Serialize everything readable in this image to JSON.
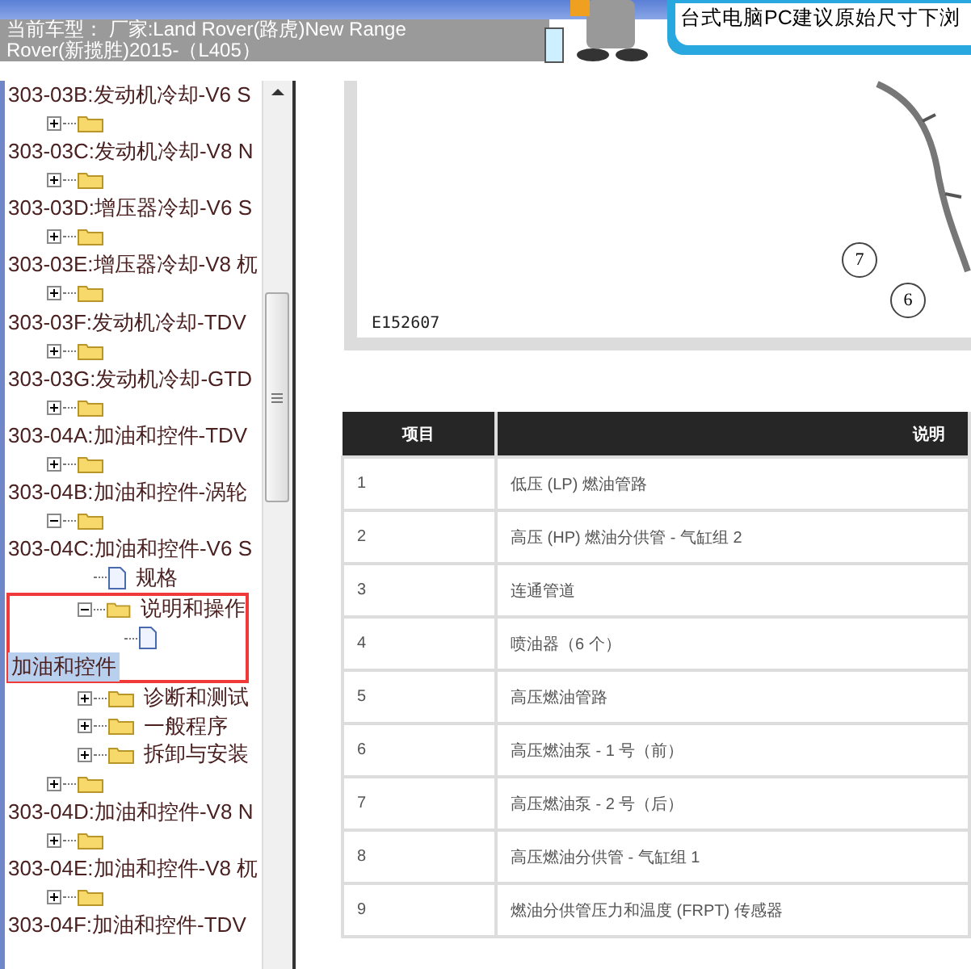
{
  "header": {
    "lines": [
      "当前车型： 厂家:Land Rover(路虎)New Range",
      "Rover(新揽胜)2015-（L405）"
    ]
  },
  "banner": {
    "text": "台式电脑PC建议原始尺寸下浏"
  },
  "tree": [
    {
      "kind": "heading",
      "label": "303-03B:发动机冷却-V6 S"
    },
    {
      "kind": "folder",
      "expanded": false
    },
    {
      "kind": "heading",
      "label": "303-03C:发动机冷却-V8 N"
    },
    {
      "kind": "folder",
      "expanded": false
    },
    {
      "kind": "heading",
      "label": "303-03D:增压器冷却-V6 S"
    },
    {
      "kind": "folder",
      "expanded": false
    },
    {
      "kind": "heading",
      "label": "303-03E:增压器冷却-V8 杌"
    },
    {
      "kind": "folder",
      "expanded": false
    },
    {
      "kind": "heading",
      "label": "303-03F:发动机冷却-TDV"
    },
    {
      "kind": "folder",
      "expanded": false
    },
    {
      "kind": "heading",
      "label": "303-03G:发动机冷却-GTD"
    },
    {
      "kind": "folder",
      "expanded": false
    },
    {
      "kind": "heading",
      "label": "303-04A:加油和控件-TDV"
    },
    {
      "kind": "folder",
      "expanded": false
    },
    {
      "kind": "heading",
      "label": "303-04B:加油和控件-涡轮"
    },
    {
      "kind": "folder",
      "expanded": true,
      "children": [
        {
          "kind": "heading",
          "label": "303-04C:加油和控件-V6 S"
        },
        {
          "kind": "doc",
          "label": "规格"
        },
        {
          "kind": "folder",
          "label": "说明和操作",
          "expanded": true,
          "framed": true,
          "children": [
            {
              "kind": "doc"
            },
            {
              "kind": "heading",
              "label": "加油和控件",
              "selected": true
            }
          ]
        },
        {
          "kind": "folder",
          "label": "诊断和测试",
          "expanded": false
        },
        {
          "kind": "folder",
          "label": "一般程序",
          "expanded": false
        },
        {
          "kind": "folder",
          "label": "拆卸与安装",
          "expanded": false
        }
      ]
    },
    {
      "kind": "folder",
      "expanded": false
    },
    {
      "kind": "heading",
      "label": "303-04D:加油和控件-V8 N"
    },
    {
      "kind": "folder",
      "expanded": false
    },
    {
      "kind": "heading",
      "label": "303-04E:加油和控件-V8 杌"
    },
    {
      "kind": "folder",
      "expanded": false
    },
    {
      "kind": "heading",
      "label": "303-04F:加油和控件-TDV"
    }
  ],
  "figure": {
    "code": "E152607",
    "callouts": [
      "7",
      "6"
    ]
  },
  "table": {
    "columns": [
      "项目",
      "说明"
    ],
    "rows": [
      [
        "1",
        "低压 (LP) 燃油管路"
      ],
      [
        "2",
        "高压 (HP) 燃油分供管 - 气缸组 2"
      ],
      [
        "3",
        "连通管道"
      ],
      [
        "4",
        "喷油器（6 个）"
      ],
      [
        "5",
        "高压燃油管路"
      ],
      [
        "6",
        "高压燃油泵 - 1 号（前）"
      ],
      [
        "7",
        "高压燃油泵 - 2 号（后）"
      ],
      [
        "8",
        "高压燃油分供管 - 气缸组 1"
      ],
      [
        "9",
        "燃油分供管压力和温度 (FRPT) 传感器"
      ]
    ]
  }
}
